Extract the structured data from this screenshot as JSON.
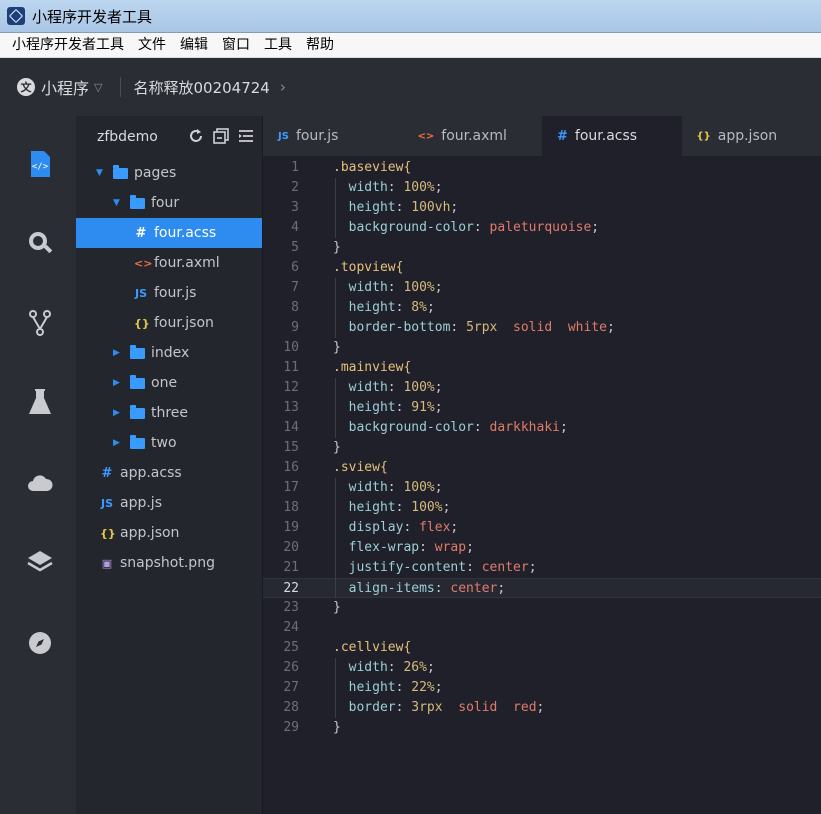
{
  "window": {
    "title": "小程序开发者工具"
  },
  "menu": [
    "小程序开发者工具",
    "文件",
    "编辑",
    "窗口",
    "工具",
    "帮助"
  ],
  "project": {
    "name": "小程序",
    "release": "名称释放00204724"
  },
  "colors": {
    "accent": "#2e8cf0",
    "background": "#1f2029",
    "panel": "#2b2d35"
  },
  "activity_icons": [
    "code-icon",
    "search-icon",
    "git-icon",
    "flask-icon",
    "cloud-icon",
    "layers-icon",
    "compass-icon"
  ],
  "explorer": {
    "title": "zfbdemo",
    "items": [
      {
        "label": "pages",
        "kind": "folder",
        "expanded": true,
        "depth": 0
      },
      {
        "label": "four",
        "kind": "folder",
        "expanded": true,
        "depth": 1
      },
      {
        "label": "four.acss",
        "kind": "acss",
        "depth": 2,
        "selected": true,
        "icon": "#"
      },
      {
        "label": "four.axml",
        "kind": "axml",
        "depth": 2,
        "icon": "<>"
      },
      {
        "label": "four.js",
        "kind": "js",
        "depth": 2,
        "icon": "JS"
      },
      {
        "label": "four.json",
        "kind": "json",
        "depth": 2,
        "icon": "{}"
      },
      {
        "label": "index",
        "kind": "folder",
        "expanded": false,
        "depth": 1
      },
      {
        "label": "one",
        "kind": "folder",
        "expanded": false,
        "depth": 1
      },
      {
        "label": "three",
        "kind": "folder",
        "expanded": false,
        "depth": 1
      },
      {
        "label": "two",
        "kind": "folder",
        "expanded": false,
        "depth": 1
      },
      {
        "label": "app.acss",
        "kind": "acss",
        "depth": 0,
        "icon": "#"
      },
      {
        "label": "app.js",
        "kind": "js",
        "depth": 0,
        "icon": "JS"
      },
      {
        "label": "app.json",
        "kind": "json",
        "depth": 0,
        "icon": "{}"
      },
      {
        "label": "snapshot.png",
        "kind": "image",
        "depth": 0,
        "icon": "▣"
      }
    ]
  },
  "tabs": [
    {
      "label": "four.js",
      "icon": "JS",
      "active": false
    },
    {
      "label": "four.axml",
      "icon": "<>",
      "active": false
    },
    {
      "label": "four.acss",
      "icon": "#",
      "active": true
    },
    {
      "label": "app.json",
      "icon": "{}",
      "active": false
    }
  ],
  "editor": {
    "current_line": 22,
    "lines": [
      [
        [
          "sel",
          ".baseview{"
        ]
      ],
      [
        [
          "prop",
          "  width"
        ],
        [
          "punc",
          ": "
        ],
        [
          "num",
          "100%"
        ],
        [
          "punc",
          ";"
        ]
      ],
      [
        [
          "prop",
          "  height"
        ],
        [
          "punc",
          ": "
        ],
        [
          "num",
          "100vh"
        ],
        [
          "punc",
          ";"
        ]
      ],
      [
        [
          "prop",
          "  background-color"
        ],
        [
          "punc",
          ": "
        ],
        [
          "val",
          "paleturquoise"
        ],
        [
          "punc",
          ";"
        ]
      ],
      [
        [
          "punc",
          "}"
        ]
      ],
      [
        [
          "sel",
          ".topview{"
        ]
      ],
      [
        [
          "prop",
          "  width"
        ],
        [
          "punc",
          ": "
        ],
        [
          "num",
          "100%"
        ],
        [
          "punc",
          ";"
        ]
      ],
      [
        [
          "prop",
          "  height"
        ],
        [
          "punc",
          ": "
        ],
        [
          "num",
          "8%"
        ],
        [
          "punc",
          ";"
        ]
      ],
      [
        [
          "prop",
          "  border-bottom"
        ],
        [
          "punc",
          ": "
        ],
        [
          "num",
          "5rpx"
        ],
        [
          "punc",
          "  "
        ],
        [
          "val",
          "solid"
        ],
        [
          "punc",
          "  "
        ],
        [
          "val",
          "white"
        ],
        [
          "punc",
          ";"
        ]
      ],
      [
        [
          "punc",
          "}"
        ]
      ],
      [
        [
          "sel",
          ".mainview{"
        ]
      ],
      [
        [
          "prop",
          "  width"
        ],
        [
          "punc",
          ": "
        ],
        [
          "num",
          "100%"
        ],
        [
          "punc",
          ";"
        ]
      ],
      [
        [
          "prop",
          "  height"
        ],
        [
          "punc",
          ": "
        ],
        [
          "num",
          "91%"
        ],
        [
          "punc",
          ";"
        ]
      ],
      [
        [
          "prop",
          "  background-color"
        ],
        [
          "punc",
          ": "
        ],
        [
          "val",
          "darkkhaki"
        ],
        [
          "punc",
          ";"
        ]
      ],
      [
        [
          "punc",
          "}"
        ]
      ],
      [
        [
          "sel",
          ".sview{"
        ]
      ],
      [
        [
          "prop",
          "  width"
        ],
        [
          "punc",
          ": "
        ],
        [
          "num",
          "100%"
        ],
        [
          "punc",
          ";"
        ]
      ],
      [
        [
          "prop",
          "  height"
        ],
        [
          "punc",
          ": "
        ],
        [
          "num",
          "100%"
        ],
        [
          "punc",
          ";"
        ]
      ],
      [
        [
          "prop",
          "  display"
        ],
        [
          "punc",
          ": "
        ],
        [
          "val",
          "flex"
        ],
        [
          "punc",
          ";"
        ]
      ],
      [
        [
          "prop",
          "  flex-wrap"
        ],
        [
          "punc",
          ": "
        ],
        [
          "val",
          "wrap"
        ],
        [
          "punc",
          ";"
        ]
      ],
      [
        [
          "prop",
          "  justify-content"
        ],
        [
          "punc",
          ": "
        ],
        [
          "val",
          "center"
        ],
        [
          "punc",
          ";"
        ]
      ],
      [
        [
          "prop",
          "  align-items"
        ],
        [
          "punc",
          ": "
        ],
        [
          "val",
          "center"
        ],
        [
          "punc",
          ";"
        ]
      ],
      [
        [
          "punc",
          "}"
        ]
      ],
      [],
      [
        [
          "sel",
          ".cellview{"
        ]
      ],
      [
        [
          "prop",
          "  width"
        ],
        [
          "punc",
          ": "
        ],
        [
          "num",
          "26%"
        ],
        [
          "punc",
          ";"
        ]
      ],
      [
        [
          "prop",
          "  height"
        ],
        [
          "punc",
          ": "
        ],
        [
          "num",
          "22%"
        ],
        [
          "punc",
          ";"
        ]
      ],
      [
        [
          "prop",
          "  border"
        ],
        [
          "punc",
          ": "
        ],
        [
          "num",
          "3rpx"
        ],
        [
          "punc",
          "  "
        ],
        [
          "val",
          "solid"
        ],
        [
          "punc",
          "  "
        ],
        [
          "val",
          "red"
        ],
        [
          "punc",
          ";"
        ]
      ],
      [
        [
          "punc",
          "}"
        ]
      ]
    ]
  }
}
